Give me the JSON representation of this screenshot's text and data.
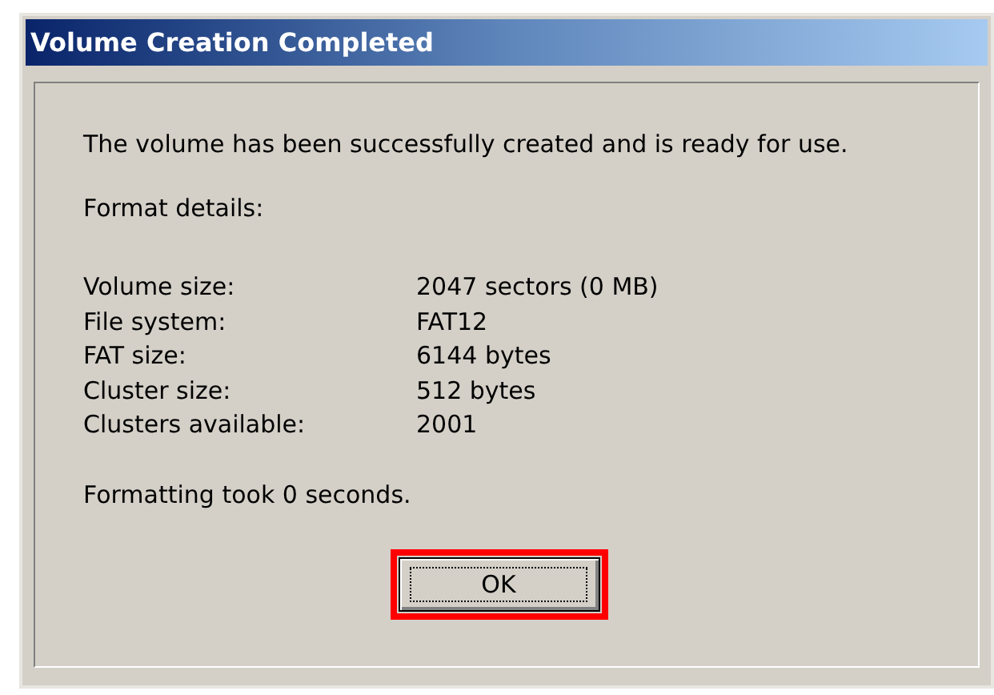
{
  "window": {
    "title": "Volume Creation Completed"
  },
  "message": "The volume has been successfully created and is ready for use.",
  "details_heading": "Format details:",
  "details": [
    {
      "label": "Volume size:",
      "value": "2047 sectors (0 MB)"
    },
    {
      "label": "File system:",
      "value": "FAT12"
    },
    {
      "label": "FAT size:",
      "value": "6144 bytes"
    },
    {
      "label": "Cluster size:",
      "value": "512 bytes"
    },
    {
      "label": "Clusters available:",
      "value": "2001"
    }
  ],
  "footer": "Formatting took 0 seconds.",
  "button": {
    "label": "OK",
    "highlighted": true
  }
}
